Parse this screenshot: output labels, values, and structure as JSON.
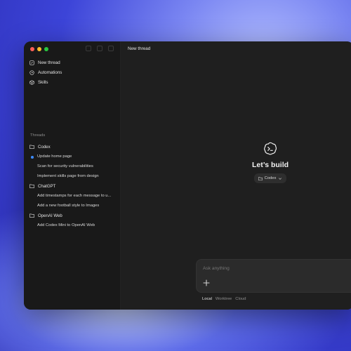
{
  "sidebar": {
    "nav": [
      {
        "label": "New thread",
        "icon": "edit-icon"
      },
      {
        "label": "Automations",
        "icon": "clock-icon"
      },
      {
        "label": "Skills",
        "icon": "cube-icon"
      }
    ],
    "threads_label": "Threads",
    "projects": [
      {
        "name": "Codex",
        "threads": [
          {
            "title": "Update home page",
            "active": true
          },
          {
            "title": "Scan for security vulnerabilities",
            "active": false
          },
          {
            "title": "Implement skills page from design",
            "active": false
          }
        ]
      },
      {
        "name": "ChatGPT",
        "threads": [
          {
            "title": "Add timestamps for each message to u...",
            "active": false
          },
          {
            "title": "Add a new football style to Images",
            "active": false
          }
        ]
      },
      {
        "name": "OpenAI Web",
        "threads": [
          {
            "title": "Add Codex Mini to OpenAI Web",
            "active": false
          }
        ]
      }
    ]
  },
  "main": {
    "title": "New thread",
    "hero_title": "Let’s build",
    "project_selector": "Codex",
    "composer_placeholder": "Ask anything",
    "modes": [
      {
        "label": "Local",
        "active": true
      },
      {
        "label": "Worktree",
        "active": false
      },
      {
        "label": "Cloud",
        "active": false
      }
    ]
  },
  "colors": {
    "accent": "#3d8cff",
    "window_bg": "#1b1b1b",
    "sidebar_bg": "#191919",
    "main_bg": "#1f1f1f"
  }
}
